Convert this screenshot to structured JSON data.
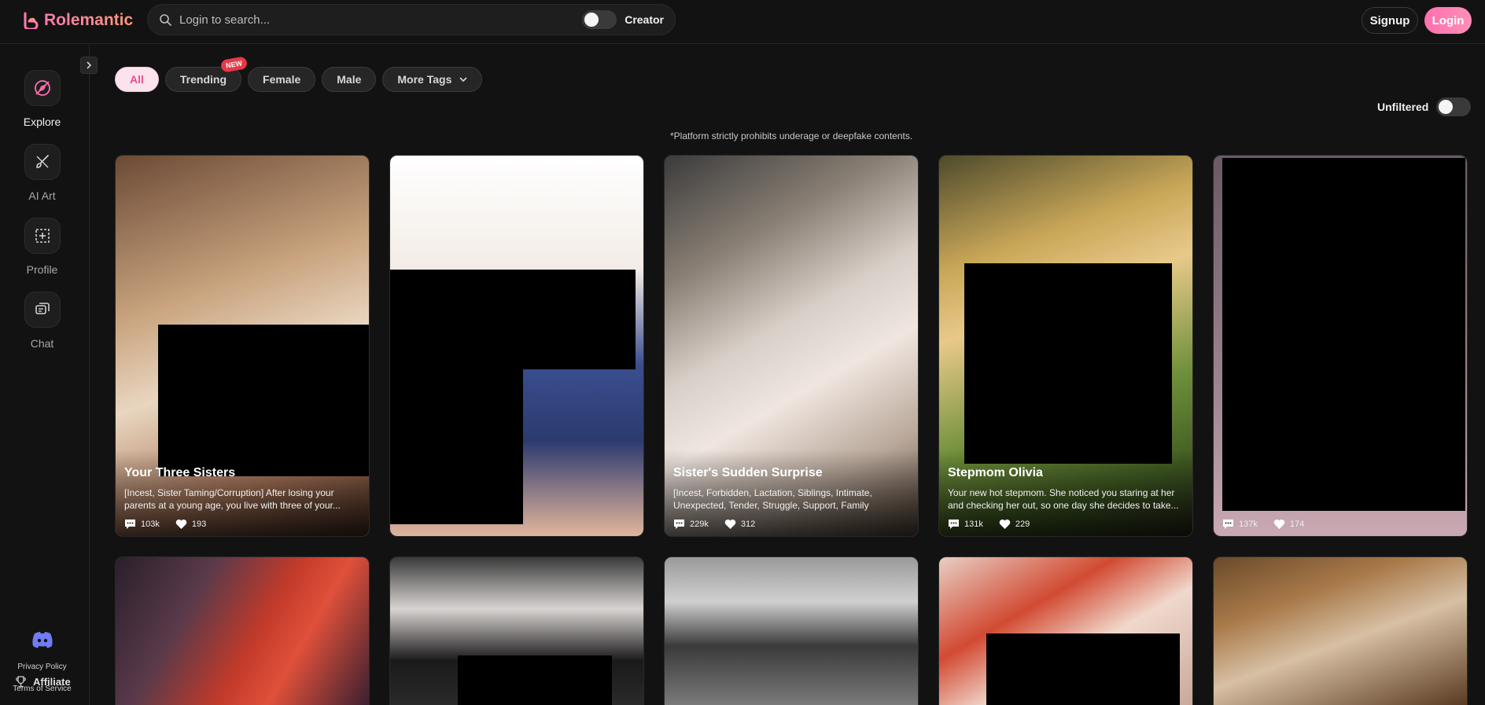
{
  "brand": {
    "name": "Rolemantic",
    "accent": "#ff79b0"
  },
  "search": {
    "placeholder": "Login to search..."
  },
  "header": {
    "creator_label": "Creator",
    "signup_label": "Signup",
    "login_label": "Login"
  },
  "sidebar": {
    "items": [
      {
        "label": "Explore",
        "icon": "compass-icon",
        "active": true
      },
      {
        "label": "AI Art",
        "icon": "brush-icon",
        "active": false
      },
      {
        "label": "Profile",
        "icon": "profile-icon",
        "active": false
      },
      {
        "label": "Chat",
        "icon": "chat-icon",
        "active": false
      }
    ],
    "affiliate_label": "Affiliate",
    "privacy_label": "Privacy Policy",
    "terms_label": "Terms of Service"
  },
  "tags": {
    "all": "All",
    "trending": "Trending",
    "new_badge": "NEW",
    "female": "Female",
    "male": "Male",
    "more": "More Tags"
  },
  "filter": {
    "unfiltered_label": "Unfiltered"
  },
  "notice": "*Platform strictly prohibits underage or deepfake contents.",
  "cards": [
    {
      "title": "Your Three Sisters",
      "desc": "[Incest, Sister Taming/Corruption] After losing your parents at a young age, you live with three of your...",
      "messages": "103k",
      "likes": "193"
    },
    {
      "title": "",
      "desc": "",
      "messages": "",
      "likes": ""
    },
    {
      "title": "Sister's Sudden Surprise",
      "desc": "[Incest, Forbidden, Lactation, Siblings, Intimate, Unexpected, Tender, Struggle, Support, Family bonds]...",
      "messages": "229k",
      "likes": "312"
    },
    {
      "title": "Stepmom Olivia",
      "desc": "Your new hot stepmom. She noticed you staring at her and checking her out, so one day she decides to take...",
      "messages": "131k",
      "likes": "229"
    },
    {
      "title": "",
      "desc": "",
      "messages": "137k",
      "likes": "174"
    }
  ]
}
